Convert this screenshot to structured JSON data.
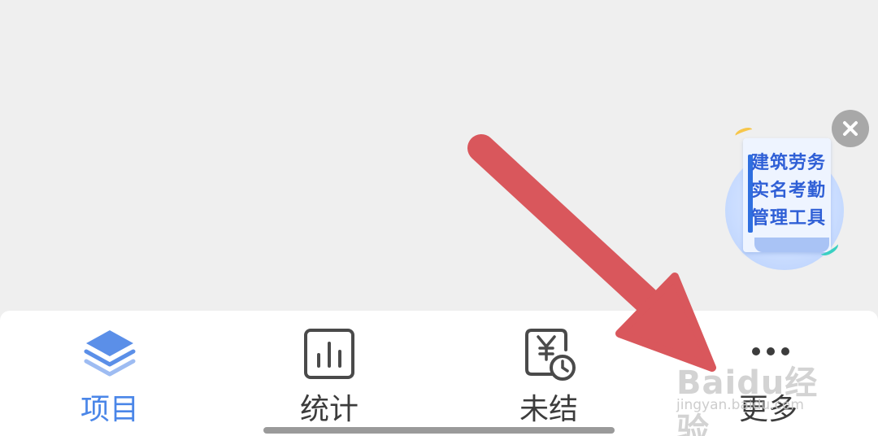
{
  "promo": {
    "lines": [
      "建筑劳务",
      "实名考勤",
      "管理工具"
    ],
    "close_icon": "close-icon",
    "accent_color": "#2f5fd6"
  },
  "tabbar": {
    "tabs": [
      {
        "label": "项目",
        "icon": "layers-icon",
        "active": true
      },
      {
        "label": "统计",
        "icon": "bar-chart-icon",
        "active": false
      },
      {
        "label": "未结",
        "icon": "yuan-clock-icon",
        "active": false
      },
      {
        "label": "更多",
        "icon": "more-dots-icon",
        "active": false
      }
    ],
    "active_color": "#4a86e8",
    "inactive_color": "#3c3c3c"
  },
  "annotation": {
    "arrow_color": "#d9534f"
  },
  "watermark": {
    "brand": "Baidu经验",
    "url": "jingyan.baidu.com"
  }
}
